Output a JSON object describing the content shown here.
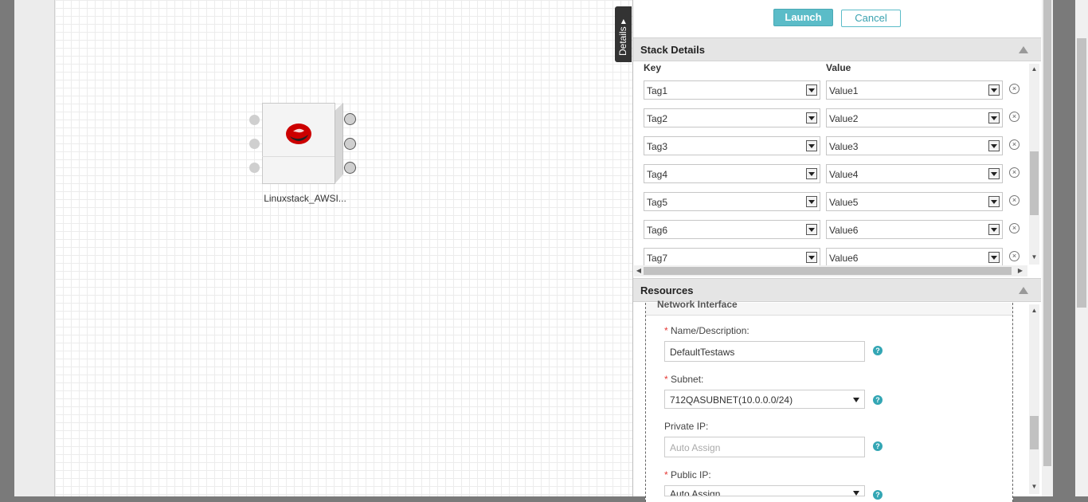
{
  "canvas": {
    "node_label": "Linuxstack_AWSI..."
  },
  "details_tab": {
    "label": "Details ▸"
  },
  "toolbar": {
    "launch_label": "Launch",
    "cancel_label": "Cancel"
  },
  "stack_details": {
    "title": "Stack Details",
    "key_header": "Key",
    "value_header": "Value",
    "rows": [
      {
        "key": "Tag1",
        "value": "Value1"
      },
      {
        "key": "Tag2",
        "value": "Value2"
      },
      {
        "key": "Tag3",
        "value": "Value3"
      },
      {
        "key": "Tag4",
        "value": "Value4"
      },
      {
        "key": "Tag5",
        "value": "Value5"
      },
      {
        "key": "Tag6",
        "value": "Value6"
      },
      {
        "key": "Tag7",
        "value": "Value6"
      }
    ],
    "remove_symbol": "×"
  },
  "resources": {
    "title": "Resources",
    "section_title": "Network Interface",
    "required_mark": "*",
    "name_label": "Name/Description:",
    "name_value": "DefaultTestaws",
    "subnet_label": "Subnet:",
    "subnet_value": "712QASUBNET(10.0.0.0/24)",
    "private_ip_label": "Private IP:",
    "private_ip_placeholder": "Auto Assign",
    "public_ip_label": "Public IP:",
    "public_ip_value": "Auto Assign",
    "help_symbol": "?"
  },
  "colors": {
    "accent": "#5bbcc8",
    "redhat": "#cc0000",
    "required": "#e53935"
  }
}
